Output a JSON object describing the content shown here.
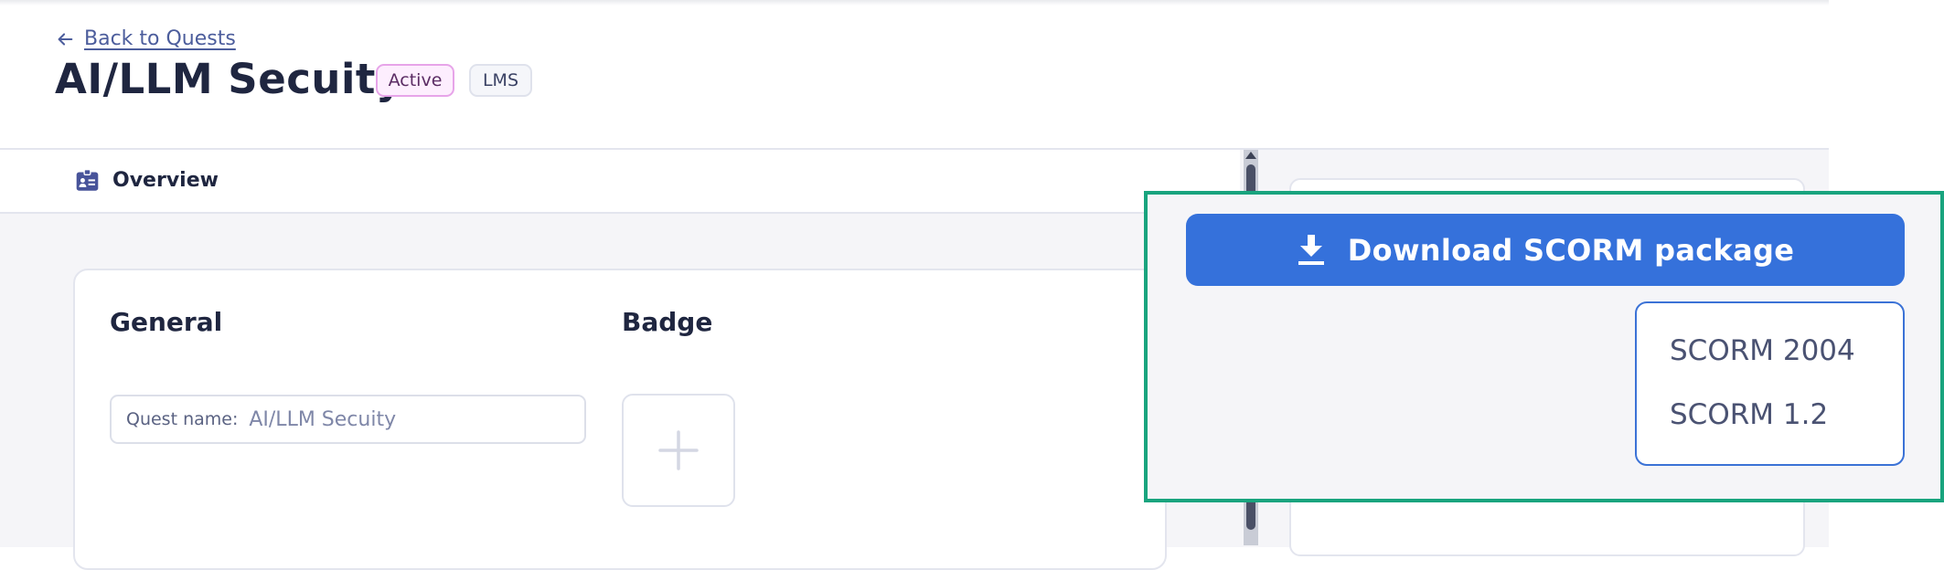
{
  "header": {
    "back_link": "Back to Quests",
    "title": "AI/LLM Secuity",
    "badges": {
      "status": "Active",
      "type": "LMS"
    }
  },
  "tabs": [
    {
      "label": "Overview",
      "icon": "id-card-icon"
    }
  ],
  "main": {
    "general_heading": "General",
    "badge_heading": "Badge",
    "quest_name_label": "Quest name:",
    "quest_name_value": "AI/LLM Secuity",
    "badge_add_icon": "plus-icon"
  },
  "popup": {
    "download_label": "Download SCORM package",
    "download_icon": "download-icon",
    "options": [
      "SCORM 2004",
      "SCORM 1.2"
    ]
  },
  "colors": {
    "primary": "#3571db",
    "highlight_border": "#19a47e",
    "active_badge_border": "#e7a4e9",
    "text_dark": "#1f2640"
  }
}
